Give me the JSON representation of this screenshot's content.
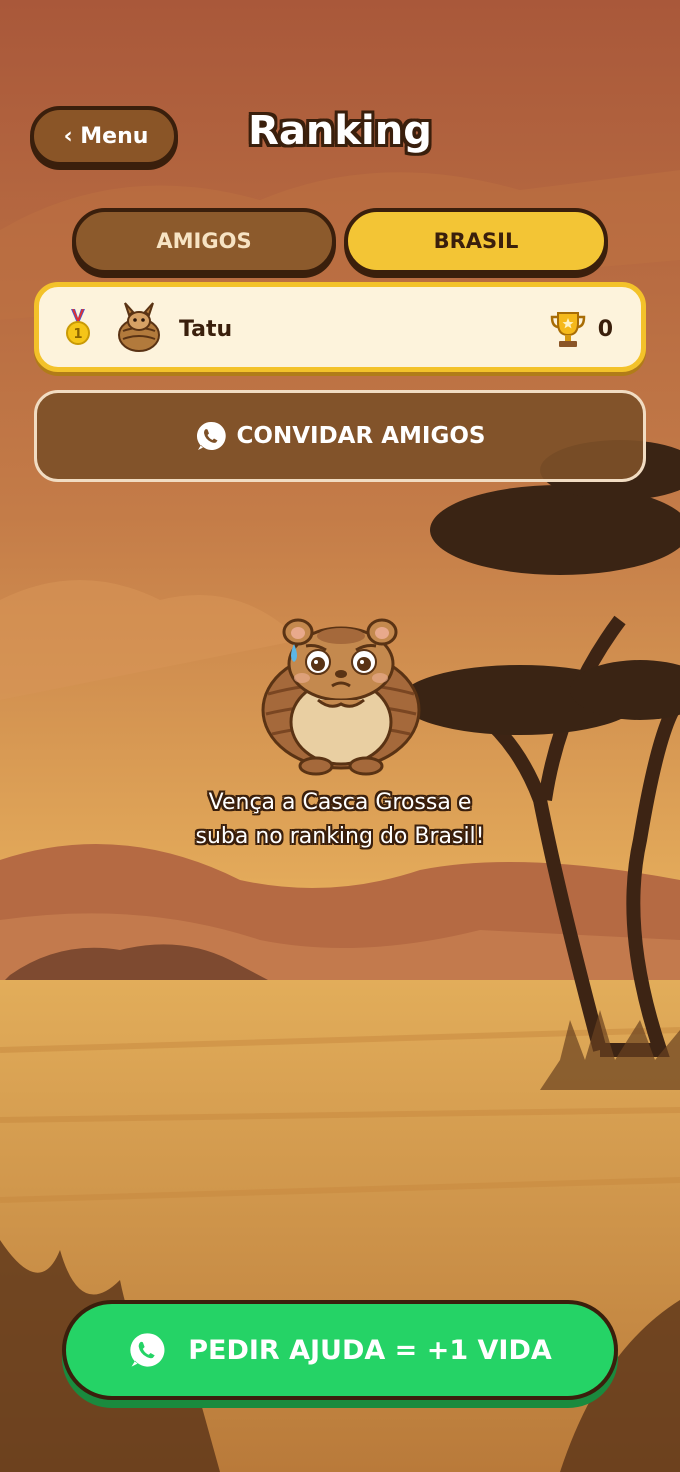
{
  "colors": {
    "accent_yellow": "#f3c535",
    "brown_dark": "#3a1f0c",
    "brown_button": "#8a5527",
    "whatsapp_green": "#25d366",
    "row_bg": "#fdf3dc"
  },
  "header": {
    "back_label": "‹ Menu",
    "title": "Ranking"
  },
  "tabs": [
    {
      "label": "AMIGOS",
      "active": false
    },
    {
      "label": "BRASIL",
      "active": true
    }
  ],
  "ranking": [
    {
      "position": "1",
      "name": "Tatu",
      "score": "0",
      "medal_icon": "gold-medal-icon",
      "avatar_icon": "armadillo-avatar-icon",
      "score_icon": "trophy-icon"
    }
  ],
  "invite": {
    "label": "CONVIDAR AMIGOS",
    "icon": "whatsapp-icon"
  },
  "empty_state": {
    "line1": "Vença a Casca Grossa e",
    "line2": "suba no ranking do Brasil!"
  },
  "help_button": {
    "label": "PEDIR AJUDA = +1 VIDA",
    "icon": "whatsapp-icon"
  }
}
